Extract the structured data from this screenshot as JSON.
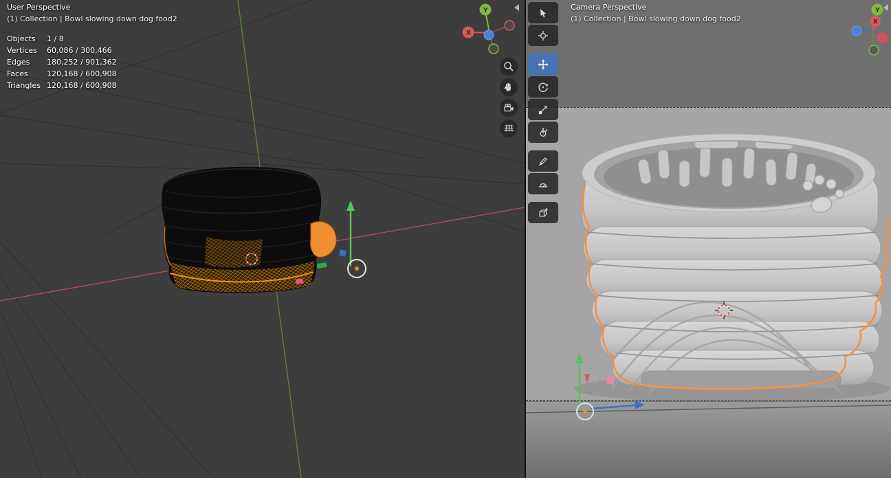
{
  "left_viewport": {
    "perspective_label": "User Perspective",
    "collection_label": "(1) Collection | Bowl slowing down dog food2",
    "stats": {
      "rows": [
        {
          "label": "Objects",
          "value": "1 / 8"
        },
        {
          "label": "Vertices",
          "value": "60,086 / 300,466"
        },
        {
          "label": "Edges",
          "value": "180,252 / 901,362"
        },
        {
          "label": "Faces",
          "value": "120,168 / 600,908"
        },
        {
          "label": "Triangles",
          "value": "120,168 / 600,908"
        }
      ]
    },
    "gizmo": {
      "x_label": "X",
      "y_label": "Y"
    },
    "nav_buttons": [
      {
        "name": "Zoom view",
        "icon": "magnifier-icon"
      },
      {
        "name": "Pan view",
        "icon": "hand-icon"
      },
      {
        "name": "Camera view",
        "icon": "camera-icon"
      },
      {
        "name": "Toggle grid",
        "icon": "grid-icon"
      }
    ]
  },
  "right_viewport": {
    "perspective_label": "Camera Perspective",
    "collection_label": "(1) Collection | Bowl slowing down dog food2",
    "gizmo": {
      "x_label": "X",
      "y_label": "Y"
    }
  },
  "toolbar": {
    "tools": [
      {
        "name": "Select Box",
        "icon": "select-box-icon",
        "active": false
      },
      {
        "name": "Cursor",
        "icon": "cursor-icon",
        "active": false
      },
      {
        "name": "Move",
        "icon": "move-icon",
        "active": true
      },
      {
        "name": "Rotate",
        "icon": "rotate-icon",
        "active": false
      },
      {
        "name": "Scale",
        "icon": "scale-icon",
        "active": false
      },
      {
        "name": "Transform",
        "icon": "transform-icon",
        "active": false
      },
      {
        "name": "Annotate",
        "icon": "annotate-icon",
        "active": false
      },
      {
        "name": "Measure",
        "icon": "measure-icon",
        "active": false
      },
      {
        "name": "Add Cube",
        "icon": "add-cube-icon",
        "active": false
      }
    ]
  },
  "colors": {
    "active_tool": "#4772b3",
    "selection_outline": "#f5923e",
    "axis_x": "#e3565e",
    "axis_y": "#6fae4c",
    "axis_z": "#3b6fc9",
    "viewport_dark": "#3d3d3d",
    "camera_inner": "#a5a5a5"
  }
}
